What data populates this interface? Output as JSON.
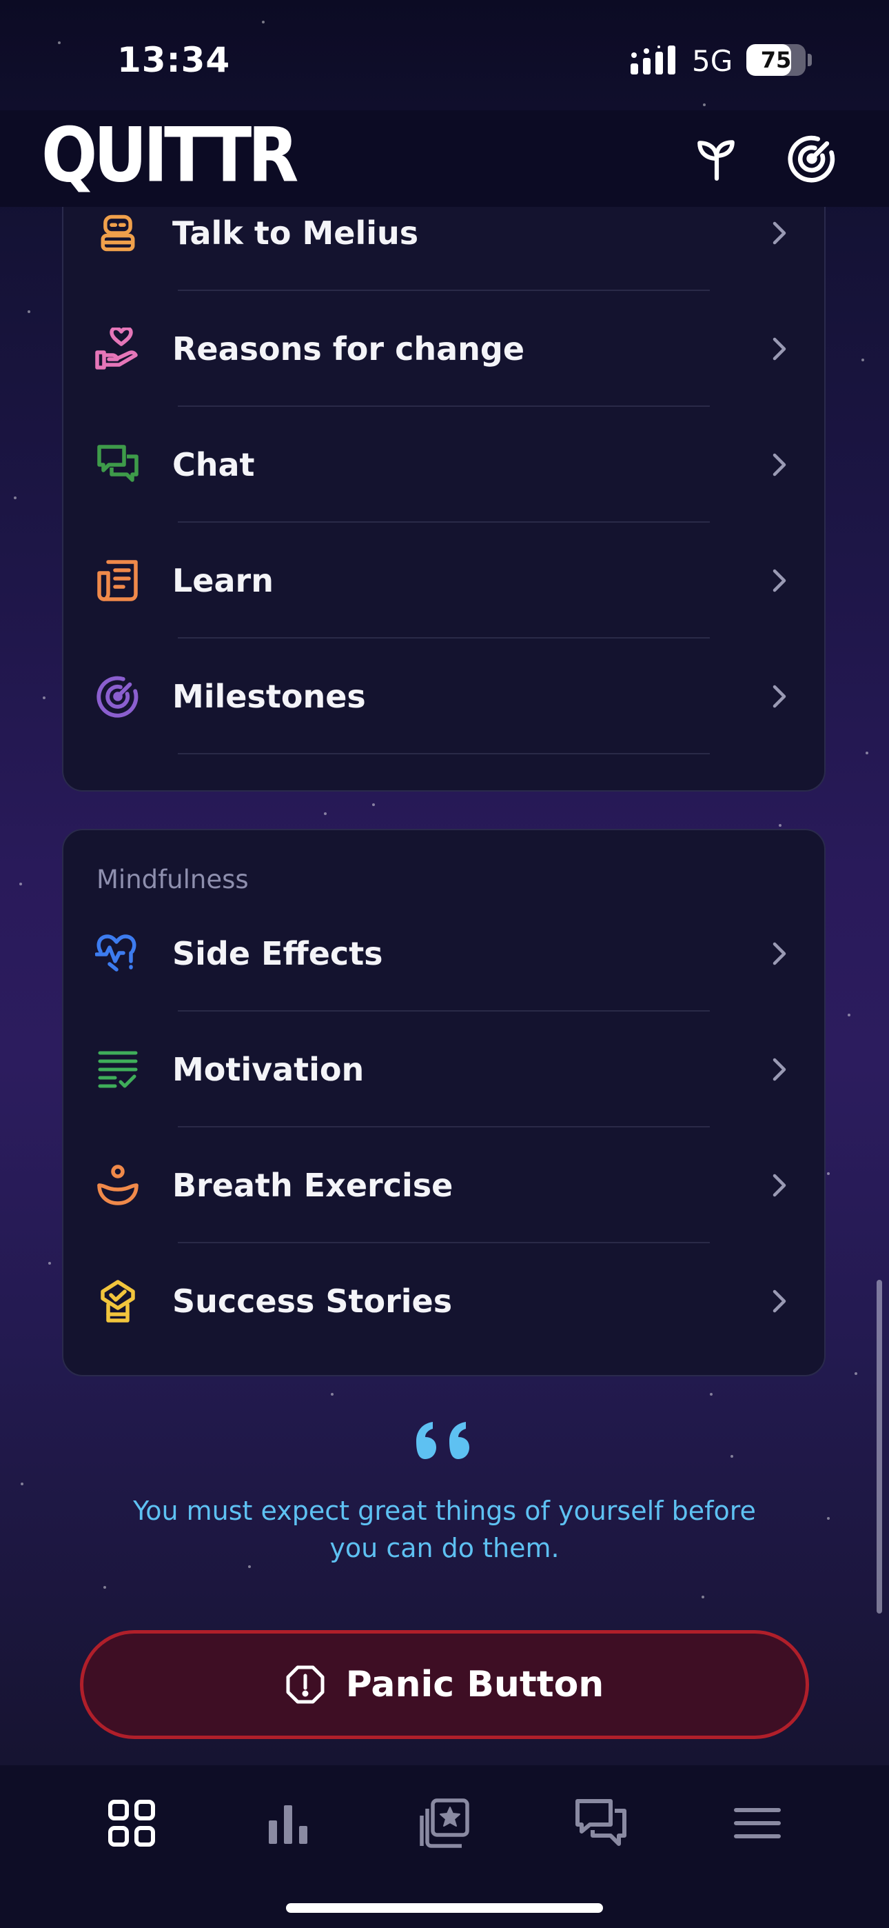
{
  "status_bar": {
    "time": "13:34",
    "network": "5G",
    "battery": "75",
    "battery_fraction": 0.75
  },
  "header": {
    "logo": "QUITTR",
    "plant_icon": "sprout-icon",
    "milestone_icon": "target-icon"
  },
  "main_list": {
    "items": [
      {
        "label": "Talk to Melius",
        "icon": "robot-icon",
        "color": "#f0a04b"
      },
      {
        "label": "Reasons for change",
        "icon": "hand-heart-icon",
        "color": "#e576b8"
      },
      {
        "label": "Chat",
        "icon": "chat-bubbles-icon",
        "color": "#3e9b4a"
      },
      {
        "label": "Learn",
        "icon": "newspaper-icon",
        "color": "#f0894a"
      },
      {
        "label": "Milestones",
        "icon": "target-icon",
        "color": "#8b5fcf"
      }
    ]
  },
  "mindfulness": {
    "title": "Mindfulness",
    "items": [
      {
        "label": "Side Effects",
        "icon": "heartbeat-alert-icon",
        "color": "#3d7cf0"
      },
      {
        "label": "Motivation",
        "icon": "checklist-icon",
        "color": "#3fae5a"
      },
      {
        "label": "Breath Exercise",
        "icon": "meditation-icon",
        "color": "#f0894a"
      },
      {
        "label": "Success Stories",
        "icon": "badge-check-icon",
        "color": "#f2c53d"
      }
    ]
  },
  "quote": {
    "text": "You must expect great things of yourself before you can do them.",
    "color": "#5ec1f2"
  },
  "panic_button": {
    "label": "Panic Button",
    "icon": "alert-circle-icon",
    "color": "#b01f2a"
  },
  "tab_bar": {
    "tabs": [
      {
        "icon": "grid-icon",
        "active": true
      },
      {
        "icon": "bar-chart-icon",
        "active": false
      },
      {
        "icon": "library-star-icon",
        "active": false
      },
      {
        "icon": "chat-icon",
        "active": false
      },
      {
        "icon": "menu-icon",
        "active": false
      }
    ]
  }
}
